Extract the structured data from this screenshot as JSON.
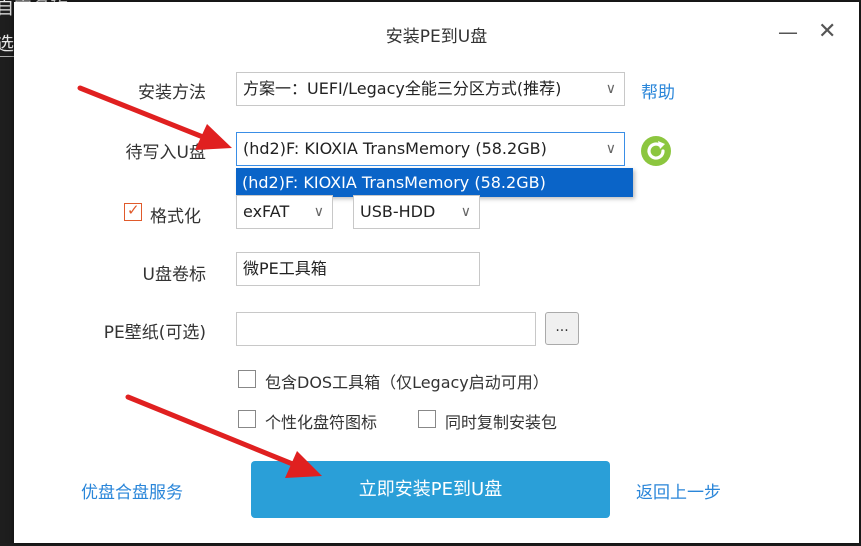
{
  "background": {
    "line1": "自定名称",
    "line2": "选"
  },
  "window": {
    "title": "安装PE到U盘",
    "minimize_glyph": "—",
    "close_glyph": "✕"
  },
  "install_method": {
    "label": "安装方法",
    "value": "方案一：UEFI/Legacy全能三分区方式(推荐)",
    "help_link": "帮助"
  },
  "target_disk": {
    "label": "待写入U盘",
    "value": "(hd2)F: KIOXIA TransMemory (58.2GB)",
    "options": [
      "(hd2)F: KIOXIA TransMemory (58.2GB)"
    ],
    "refresh_icon": "refresh-icon"
  },
  "format": {
    "label": "格式化",
    "checked": true,
    "filesystem": "exFAT",
    "mode": "USB-HDD"
  },
  "volume_label": {
    "label": "U盘卷标",
    "value": "微PE工具箱"
  },
  "wallpaper": {
    "label": "PE壁纸(可选)",
    "value": "",
    "browse_label": "..."
  },
  "options": {
    "include_dos": "包含DOS工具箱（仅Legacy启动可用）",
    "custom_icon": "个性化盘符图标",
    "copy_installer": "同时复制安装包"
  },
  "footer": {
    "left_link": "优盘合盘服务",
    "install_button": "立即安装PE到U盘",
    "back_link": "返回上一步"
  },
  "colors": {
    "accent": "#2a9fd8",
    "link": "#2a86d9",
    "selection": "#0a64c8",
    "annotation_arrow": "#e02020"
  }
}
